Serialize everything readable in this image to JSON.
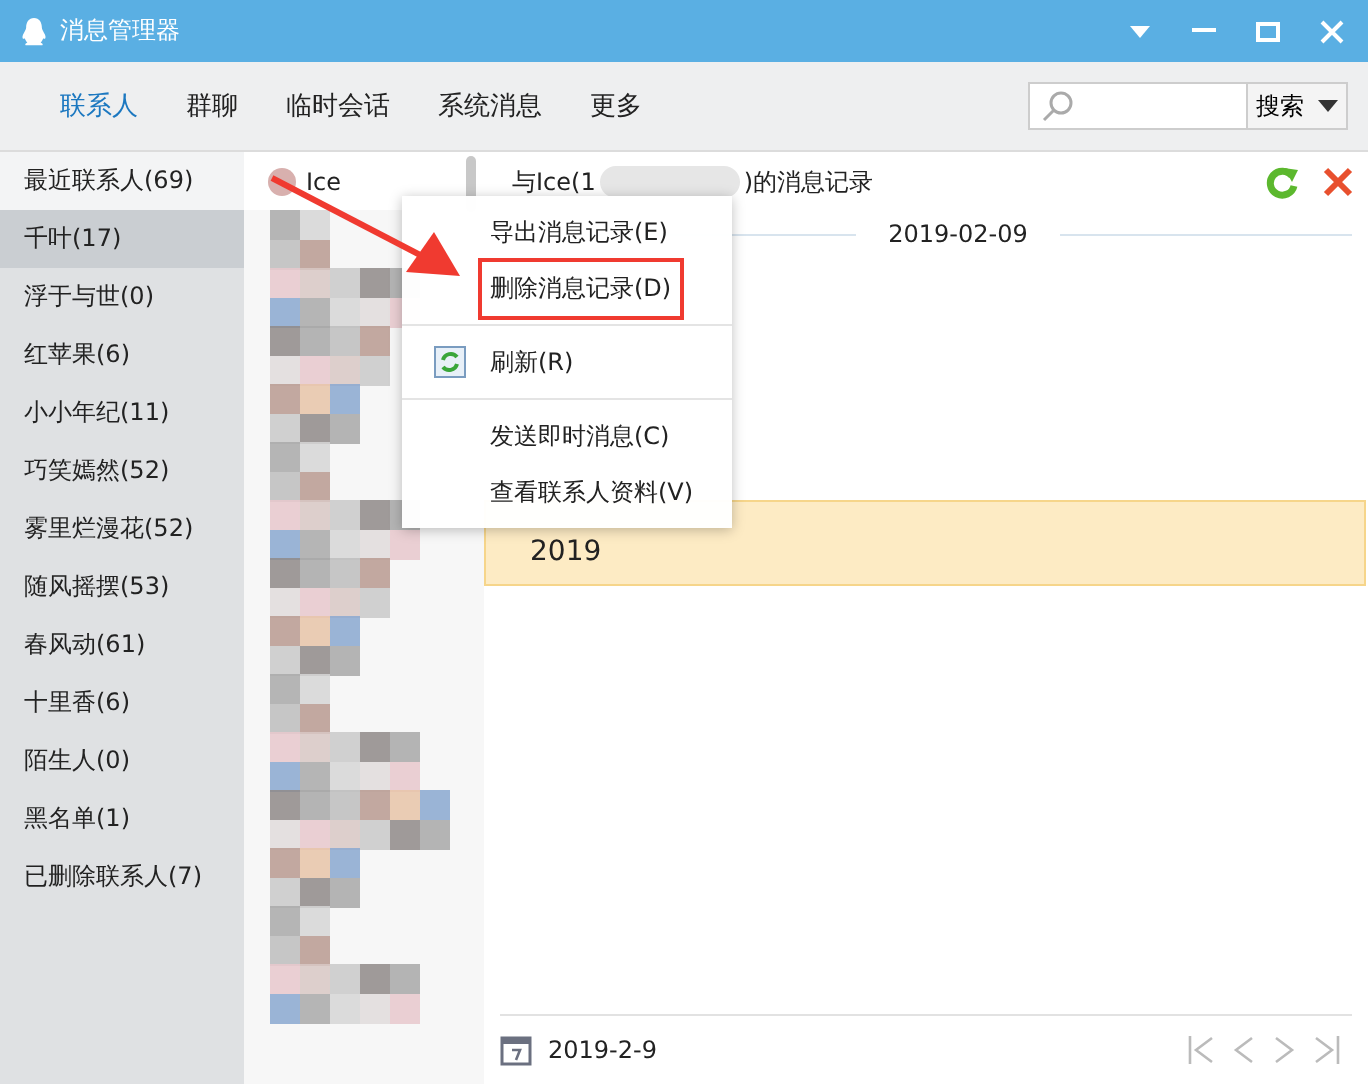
{
  "window": {
    "title": "消息管理器"
  },
  "tabs": [
    {
      "label": "联系人",
      "selected": true
    },
    {
      "label": "群聊",
      "selected": false
    },
    {
      "label": "临时会话",
      "selected": false
    },
    {
      "label": "系统消息",
      "selected": false
    },
    {
      "label": "更多",
      "selected": false
    }
  ],
  "search": {
    "button": "搜索"
  },
  "sidebar": {
    "items": [
      {
        "label": "最近联系人(69)",
        "selected": false
      },
      {
        "label": "千叶(17)",
        "selected": true
      },
      {
        "label": "浮于与世(0)",
        "selected": false
      },
      {
        "label": "红苹果(6)",
        "selected": false
      },
      {
        "label": "小小年纪(11)",
        "selected": false
      },
      {
        "label": "巧笑嫣然(52)",
        "selected": false
      },
      {
        "label": "雾里烂漫花(52)",
        "selected": false
      },
      {
        "label": "随风摇摆(53)",
        "selected": false
      },
      {
        "label": "春风动(61)",
        "selected": false
      },
      {
        "label": "十里香(6)",
        "selected": false
      },
      {
        "label": "陌生人(0)",
        "selected": false
      },
      {
        "label": "黑名单(1)",
        "selected": false
      },
      {
        "label": "已删除联系人(7)",
        "selected": false
      }
    ]
  },
  "contacts": [
    {
      "name": "Ice"
    }
  ],
  "chat": {
    "title_start": "与Ice(1",
    "title_end": ")的消息记录",
    "date": "2019-02-09",
    "messages": [
      {
        "text": "2019",
        "highlighted": true
      }
    ],
    "footer_date": "2019-2-9"
  },
  "context_menu": {
    "groups": [
      [
        {
          "label": "导出消息记录(E)",
          "annotated": false,
          "kind": "text"
        },
        {
          "label": "删除消息记录(D)",
          "annotated": true,
          "kind": "text"
        }
      ],
      [
        {
          "label": "刷新(R)",
          "annotated": false,
          "kind": "icon"
        }
      ],
      [
        {
          "label": "发送即时消息(C)",
          "annotated": false,
          "kind": "text"
        },
        {
          "label": "查看联系人资料(V)",
          "annotated": false,
          "kind": "text"
        }
      ]
    ]
  }
}
